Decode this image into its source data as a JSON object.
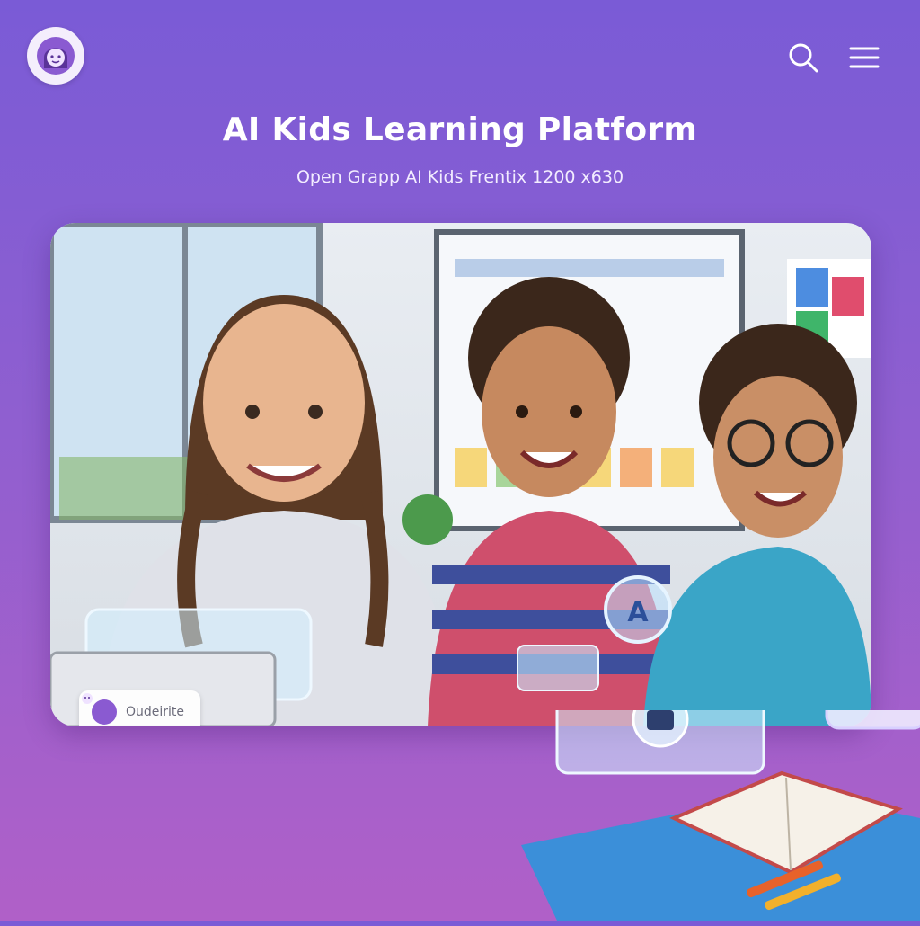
{
  "header": {
    "title": "AI Kids Learning Platform",
    "subtitle": "Open Grapp AI Kids Frentix 1200 x630"
  },
  "icons": {
    "logo": "kid-face-icon",
    "search": "search-icon",
    "menu": "hamburger-menu-icon"
  },
  "hero": {
    "chip_label": "Oudeirite"
  },
  "colors": {
    "background_top": "#7a5bd6",
    "background_bottom": "#b060c8",
    "accent": "#8a5ad1",
    "desk": "#3b8fd9"
  }
}
